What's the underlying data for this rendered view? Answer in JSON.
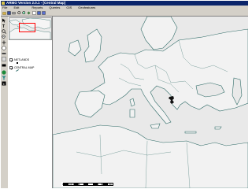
{
  "window": {
    "title": "ARMO   Version 2.0.1  - [Central Map]"
  },
  "menu": [
    "File",
    "Edit",
    "Reports",
    "Queries",
    "GIS",
    "Geofeatures"
  ],
  "toolbar_icons": [
    "open-icon",
    "save-icon",
    "print-icon",
    "zoom-in-icon",
    "zoom-out-icon",
    "pan-icon",
    "identify-icon",
    "layers-icon",
    "table-icon"
  ],
  "left_tools": [
    "select-icon",
    "text-icon",
    "zoom-icon",
    "zoom-out-icon",
    "pan-icon",
    "info-icon",
    "measure-icon",
    "grid-icon",
    "flag-icon",
    "globe-icon",
    "filter-icon",
    "info-i-icon"
  ],
  "legend": {
    "layers": [
      {
        "name": "NETLANDS",
        "checked": true
      },
      {
        "name": "CENTRAL MAP",
        "checked": true
      }
    ]
  },
  "scale": {
    "labels": [
      "0",
      "100",
      "200",
      "300",
      "400",
      "500",
      "600"
    ]
  },
  "colors": {
    "title_bar": "#0a246a",
    "map_background": "#e9e9e9",
    "coastline": "#2f6b67",
    "highlight": "#ff0000"
  }
}
